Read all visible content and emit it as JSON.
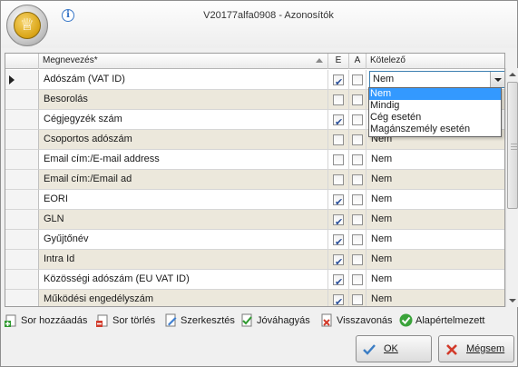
{
  "window": {
    "title": "V20177alfa0908 - Azonosítók"
  },
  "grid": {
    "columns": {
      "name": "Megnevezés*",
      "e": "E",
      "a": "A",
      "kotelezo": "Kötelező"
    },
    "rows": [
      {
        "name": "Adószám (VAT ID)",
        "e": true,
        "a": false,
        "kotelezo": "Nem",
        "current": true
      },
      {
        "name": "Besorolás",
        "e": false,
        "a": false,
        "kotelezo": ""
      },
      {
        "name": "Cégjegyzék szám",
        "e": true,
        "a": false,
        "kotelezo": ""
      },
      {
        "name": "Csoportos adószám",
        "e": false,
        "a": false,
        "kotelezo": "Nem"
      },
      {
        "name": "Email cím:/E-mail address",
        "e": false,
        "a": false,
        "kotelezo": "Nem"
      },
      {
        "name": "Email cím:/Email ad",
        "e": false,
        "a": false,
        "kotelezo": "Nem"
      },
      {
        "name": "EORI",
        "e": true,
        "a": false,
        "kotelezo": "Nem"
      },
      {
        "name": "GLN",
        "e": true,
        "a": false,
        "kotelezo": "Nem"
      },
      {
        "name": "Gyűjtőnév",
        "e": true,
        "a": false,
        "kotelezo": "Nem"
      },
      {
        "name": "Intra Id",
        "e": true,
        "a": false,
        "kotelezo": "Nem"
      },
      {
        "name": "Közösségi adószám (EU VAT ID)",
        "e": true,
        "a": false,
        "kotelezo": "Nem"
      },
      {
        "name": "Működési engedélyszám",
        "e": true,
        "a": false,
        "kotelezo": "Nem"
      }
    ]
  },
  "dropdown": {
    "options": [
      "Nem",
      "Mindig",
      "Cég esetén",
      "Magánszemély esetén"
    ],
    "selected_index": 0
  },
  "toolbar": {
    "add": "Sor hozzáadás",
    "delete": "Sor törlés",
    "edit": "Szerkesztés",
    "approve": "Jóváhagyás",
    "revert": "Visszavonás",
    "default": "Alapértelmezett"
  },
  "footer": {
    "ok": "OK",
    "cancel": "Mégsem"
  },
  "colors": {
    "alt_row": "#ece8dc",
    "selection": "#3399ff",
    "checkmark": "#2a4f9a"
  }
}
